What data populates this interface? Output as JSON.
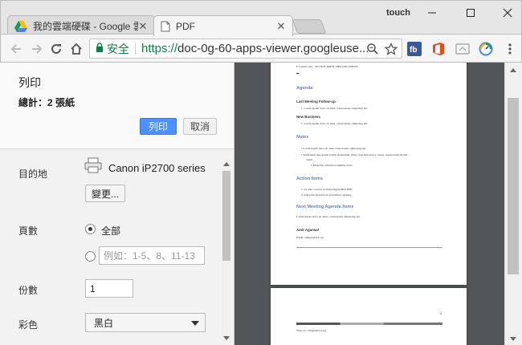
{
  "browser": {
    "tabs": [
      {
        "label": "我的雲端硬碟 - Google 雲",
        "icon": "google-drive-icon"
      },
      {
        "label": "PDF",
        "icon": "page-icon"
      }
    ],
    "user": "touch",
    "address": {
      "secure_label": "安全",
      "url_scheme": "https://",
      "url_rest": "doc-0g-60-apps-viewer.googleuse..."
    }
  },
  "print": {
    "title": "列印",
    "summary": "總計：2 張紙",
    "print_label": "列印",
    "cancel_label": "取消",
    "destination": {
      "label": "目的地",
      "printer": "Canon iP2700 series",
      "change_label": "變更..."
    },
    "pages": {
      "label": "頁數",
      "all_label": "全部",
      "custom_placeholder": "例如：1-5、8、11-13"
    },
    "copies": {
      "label": "份數",
      "value": "1"
    },
    "color": {
      "label": "彩色",
      "value": "黑白"
    }
  },
  "preview": {
    "page1": {
      "header_line": "For slides only - DO NOT PRINT THIS DOCUMENT",
      "agenda_title": "Agenda",
      "item1_title": "Last Meeting Follow-up",
      "item1_text": "1.    Lorem ipsum dolor sit amet, consectetuer adipiscing elit.",
      "item2_title": "New Business",
      "item2_text": "1.    Lorem ipsum dolor sit amet, consectetuer adipiscing elit.",
      "notes_title": "Notes",
      "notes_1": "•    Lorem ipsum dolor sit amet consectetuer adipiscing elit.",
      "notes_2": "•    Vestibulum ante ipsum primis elementum, libero interdum auctor cursus, sapien enim dictum",
      "notes_2b": "quam.",
      "notes_3": "o    Phasellus vehicula nonummy nunc.",
      "action_title": "Action Items",
      "action_1": "1.    Ut odio a ornare porttitor/dignissimid PDF",
      "action_2": "2.    Add print instructions in dataflow printing",
      "next_title": "Next Meeting Agenda Items",
      "next_text": "Lorem ipsum dolor sit amet, consectetuer adipiscing elit.",
      "author_name": "Amit Agarwal",
      "author_email": "Email: amit@labnol.org"
    },
    "page2": {
      "page_number": "2",
      "footer_text": "Write to: ctrlq@labnol.org"
    }
  },
  "colors": {
    "accent": "#4d90fe",
    "secure": "#0b8043",
    "preview_bg": "#525659"
  }
}
